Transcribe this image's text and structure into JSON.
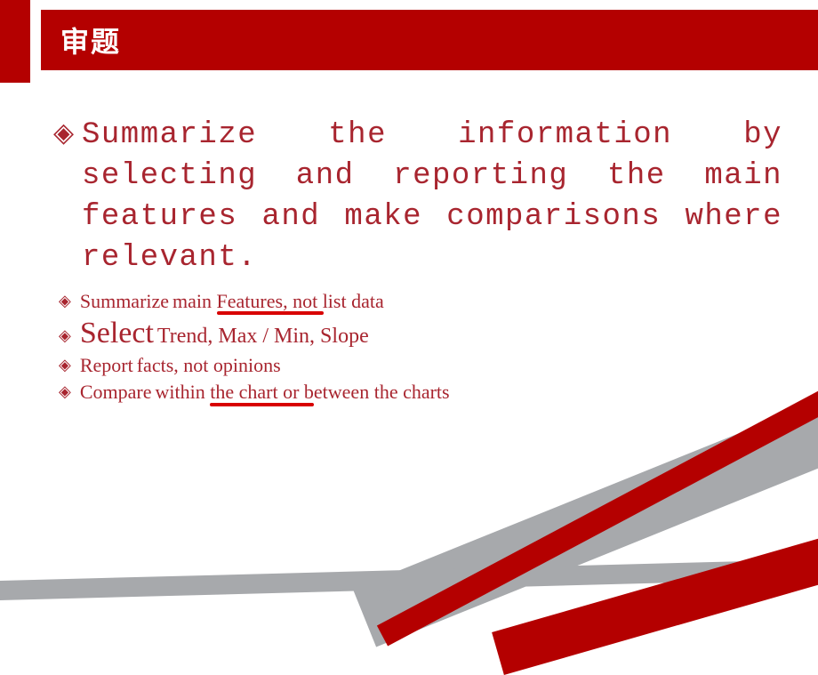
{
  "header": {
    "title": "审题"
  },
  "main": {
    "summary": "Summarize the information by selecting and reporting the main features and make comparisons where relevant."
  },
  "bullets": {
    "summarize": {
      "keyword": "Summarize",
      "spacer": "  ",
      "pre_underline": "main ",
      "underlined": "Features,",
      "post_underline": " not list data"
    },
    "select": {
      "keyword": "Select",
      "spacer": "  ",
      "desc": "Trend, Max / Min, Slope"
    },
    "report": {
      "keyword": "Report",
      "spacer": " ",
      "desc": "facts, not opinions"
    },
    "compare": {
      "keyword": "Compare",
      "spacer": " ",
      "pre_underline": "within  ",
      "underlined": "the chart or b",
      "post_underline": "etween the charts"
    }
  },
  "bullet_glyph": "◈"
}
